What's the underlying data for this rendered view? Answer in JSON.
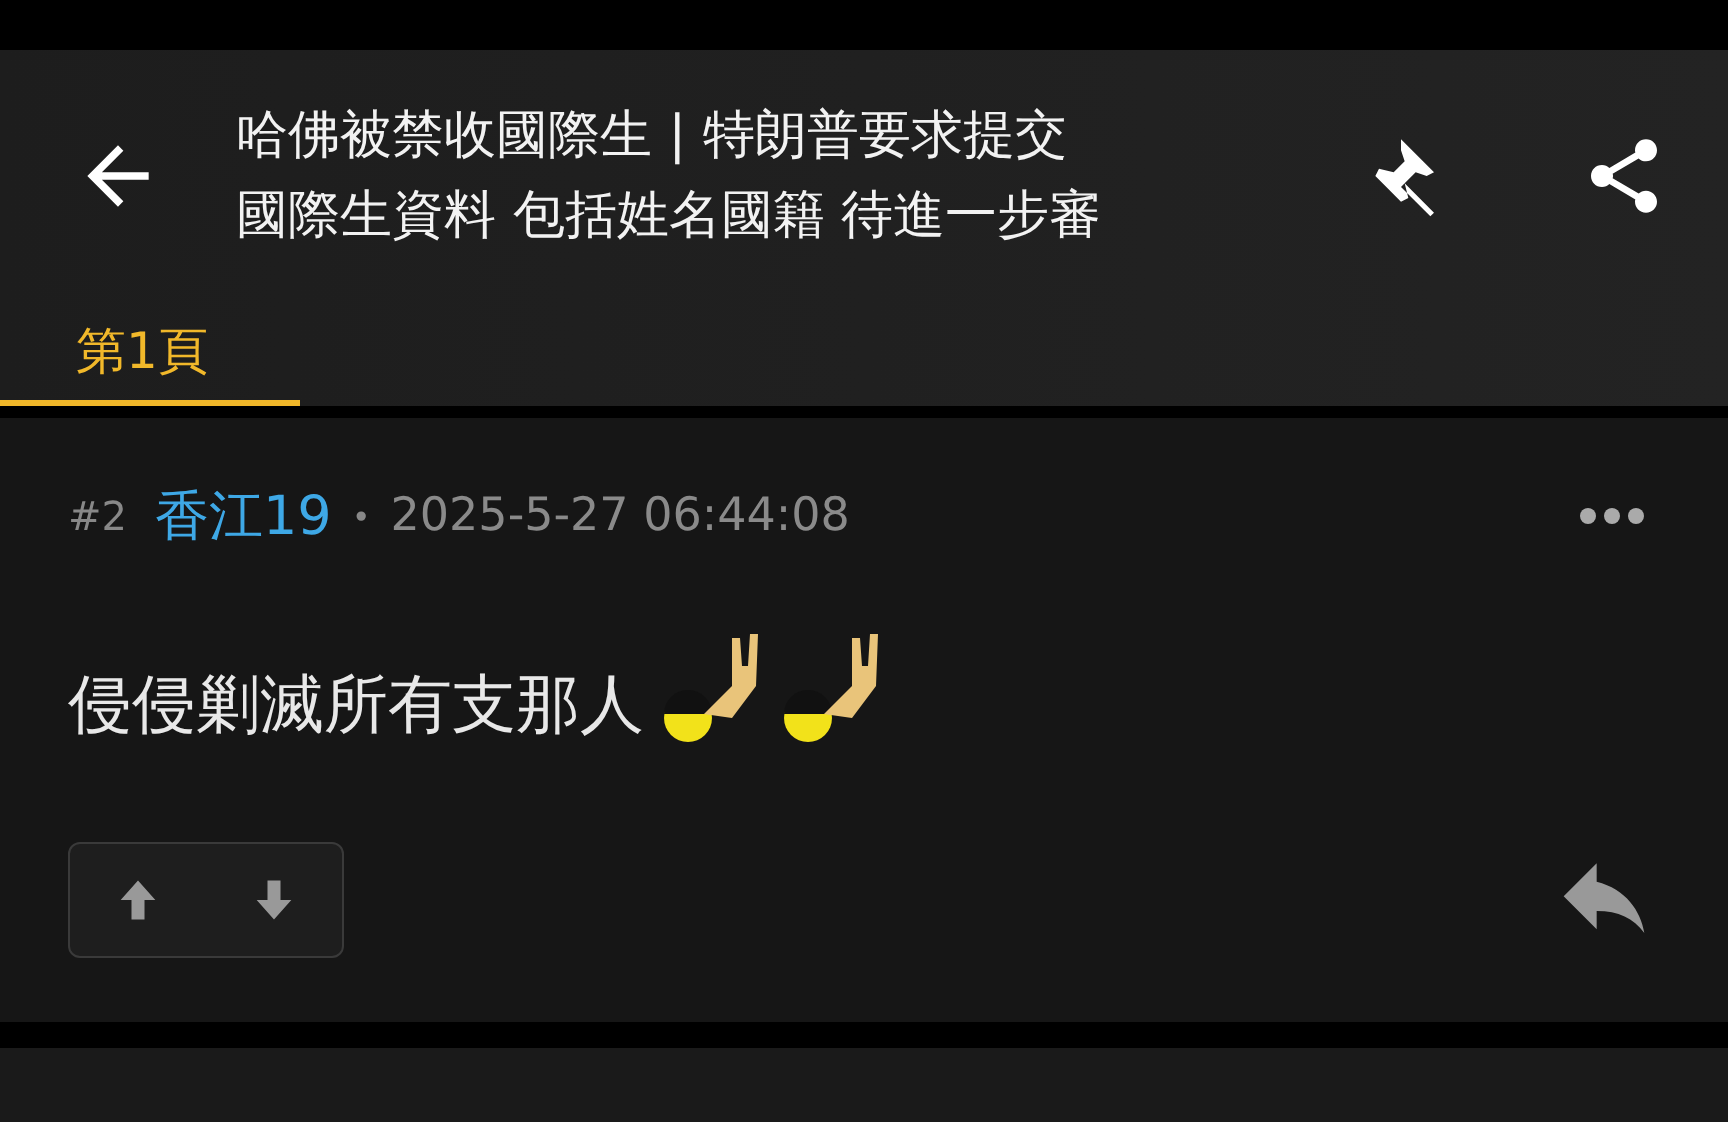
{
  "header": {
    "title_lines": [
      "哈佛被禁收國際生 | 特朗普要求提交",
      "國際生資料 包括姓名國籍 待進一步審"
    ]
  },
  "tabs": [
    {
      "label": "第1頁",
      "selected": true
    }
  ],
  "post": {
    "floor": "#2",
    "author": "香江19",
    "separator": "•",
    "time": "2025-5-27 06:44:08",
    "body": "侵侵剿滅所有支那人",
    "emojis": [
      {
        "kind": "emoji"
      },
      {
        "kind": "emoji"
      }
    ]
  }
}
